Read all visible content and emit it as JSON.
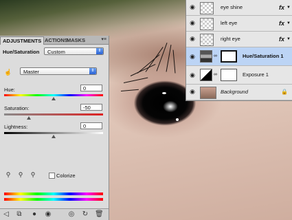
{
  "adjustments_panel": {
    "tabs": [
      {
        "label": "ADJUSTMENTS"
      },
      {
        "label": "ACTIONS"
      },
      {
        "label": "MASKS"
      }
    ],
    "panel_menu_icon": "panel-menu-icon",
    "title": "Hue/Saturation",
    "preset_value": "Custom",
    "channel_value": "Master",
    "hue": {
      "label": "Hue:",
      "value": "0"
    },
    "saturation": {
      "label": "Saturation:",
      "value": "-50"
    },
    "lightness": {
      "label": "Lightness:",
      "value": "0"
    },
    "colorize_label": "Colorize",
    "bottom_icons": [
      "back-icon",
      "clip-icon",
      "mask-link-icon",
      "eye-icon",
      "view-previous-icon",
      "reset-icon",
      "trash-icon"
    ]
  },
  "layers_panel": {
    "layers": [
      {
        "name": "eye shine",
        "type": "fx"
      },
      {
        "name": "left eye",
        "type": "fx"
      },
      {
        "name": "right eye",
        "type": "fx"
      },
      {
        "name": "Hue/Saturation 1",
        "type": "adjustment",
        "selected": true
      },
      {
        "name": "Exposure 1",
        "type": "adjustment"
      },
      {
        "name": "Background",
        "type": "background"
      }
    ],
    "fx_label": "fx"
  },
  "colors": {
    "selected_layer": "#bcd4f5",
    "select_accent": "#2b63d6"
  }
}
